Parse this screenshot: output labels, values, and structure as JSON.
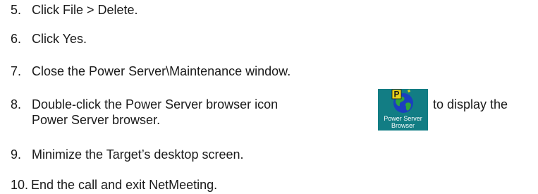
{
  "steps": [
    {
      "number": "5.",
      "text": "Click File > Delete."
    },
    {
      "number": "6.",
      "text": "Click Yes."
    },
    {
      "number": "7.",
      "text": "Close the Power Server\\Maintenance window."
    },
    {
      "number": "8.",
      "text": "Double-click the Power Server browser icon",
      "text_after_icon": "to display the",
      "continuation": "Power Server browser."
    },
    {
      "number": "9.",
      "text": "Minimize the Target’s desktop screen."
    },
    {
      "number": "10.",
      "text": "End the call and exit NetMeeting."
    }
  ],
  "browser_icon": {
    "icon": "power-server-browser-icon",
    "caption_line1": "Power Server",
    "caption_line2": "Browser",
    "background_color": "#127d84"
  }
}
